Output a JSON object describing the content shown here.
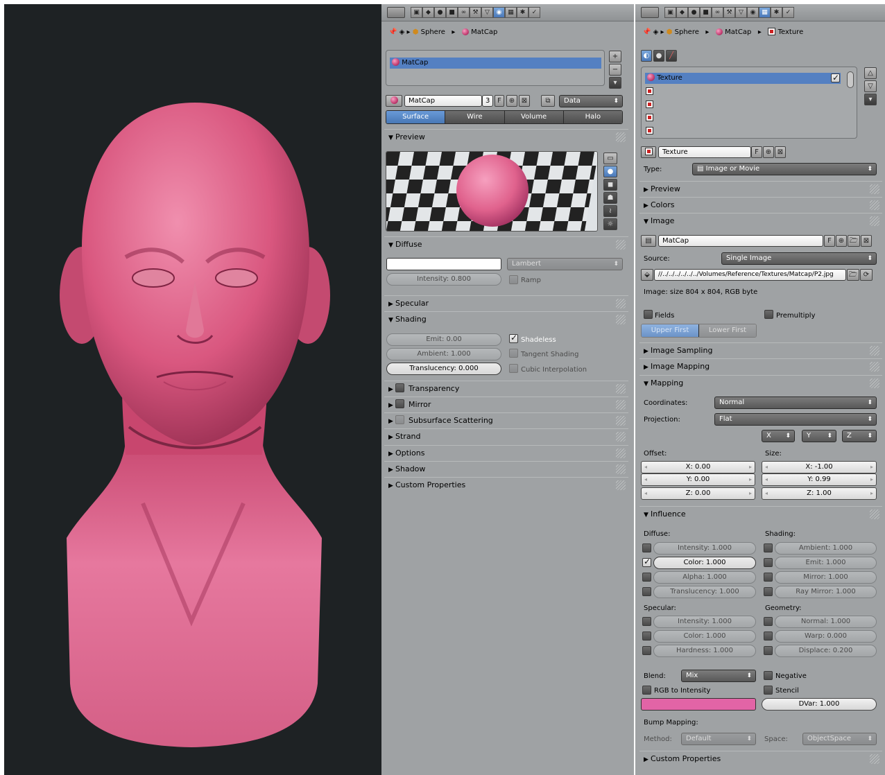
{
  "p1": {
    "crumbs": {
      "object": "Sphere",
      "material": "MatCap"
    },
    "slots": [
      "MatCap"
    ],
    "datablock": {
      "name": "MatCap",
      "users": "3",
      "fake": "F",
      "link": "Data"
    },
    "tabs": [
      "Surface",
      "Wire",
      "Volume",
      "Halo"
    ],
    "sections": {
      "preview": "Preview",
      "diffuse": "Diffuse",
      "specular": "Specular",
      "shading": "Shading",
      "transparency": "Transparency",
      "mirror": "Mirror",
      "sss": "Subsurface Scattering",
      "strand": "Strand",
      "options": "Options",
      "shadow": "Shadow",
      "custom": "Custom Properties"
    },
    "diffuse": {
      "color": "#ffffff",
      "shader": "Lambert",
      "intensity": "Intensity: 0.800",
      "ramp": "Ramp"
    },
    "shading": {
      "emit": "Emit: 0.00",
      "ambient": "Ambient: 1.000",
      "translucency": "Translucency: 0.000",
      "shadeless": "Shadeless",
      "tangent": "Tangent Shading",
      "cubic": "Cubic Interpolation",
      "shadeless_checked": true
    }
  },
  "p2": {
    "crumbs": {
      "object": "Sphere",
      "material": "MatCap",
      "texture": "Texture"
    },
    "slots": [
      "Texture",
      "",
      "",
      "",
      ""
    ],
    "texname": "Texture",
    "fake": "F",
    "type_label": "Type:",
    "type_value": "Image or Movie",
    "sections": {
      "preview": "Preview",
      "colors": "Colors",
      "image": "Image",
      "sampling": "Image Sampling",
      "imapping": "Image Mapping",
      "mapping": "Mapping",
      "influence": "Influence",
      "custom": "Custom Properties"
    },
    "image": {
      "name": "MatCap",
      "fake": "F",
      "source_label": "Source:",
      "source": "Single Image",
      "path": "//../../../../../../Volumes/Reference/Textures/Matcap/P2.jpg",
      "info": "Image: size 804 x 804, RGB byte",
      "fields": "Fields",
      "premultiply": "Premultiply",
      "upper": "Upper First",
      "lower": "Lower First"
    },
    "mapping": {
      "coords_label": "Coordinates:",
      "coords": "Normal",
      "proj_label": "Projection:",
      "proj": "Flat",
      "axes": [
        "X",
        "Y",
        "Z"
      ],
      "offset_label": "Offset:",
      "size_label": "Size:",
      "offset": [
        "X: 0.00",
        "Y: 0.00",
        "Z: 0.00"
      ],
      "size": [
        "X: -1.00",
        "Y: 0.99",
        "Z: 1.00"
      ]
    },
    "influence": {
      "diffuse_label": "Diffuse:",
      "shading_label": "Shading:",
      "specular_label": "Specular:",
      "geometry_label": "Geometry:",
      "diffuse": [
        "Intensity: 1.000",
        "Color: 1.000",
        "Alpha: 1.000",
        "Translucency: 1.000"
      ],
      "shading": [
        "Ambient: 1.000",
        "Emit: 1.000",
        "Mirror: 1.000",
        "Ray Mirror: 1.000"
      ],
      "specular": [
        "Intensity: 1.000",
        "Color: 1.000",
        "Hardness: 1.000"
      ],
      "geometry": [
        "Normal: 1.000",
        "Warp: 0.000",
        "Displace: 0.200"
      ],
      "blend_label": "Blend:",
      "blend": "Mix",
      "negative": "Negative",
      "rgb": "RGB to Intensity",
      "stencil": "Stencil",
      "dvar": "DVar: 1.000",
      "color": "#e264a6",
      "bump_label": "Bump Mapping:",
      "method_label": "Method:",
      "method": "Default",
      "space_label": "Space:",
      "space": "ObjectSpace"
    }
  },
  "colors": {
    "skin": "#d9577f",
    "accent": "#5480c2"
  }
}
